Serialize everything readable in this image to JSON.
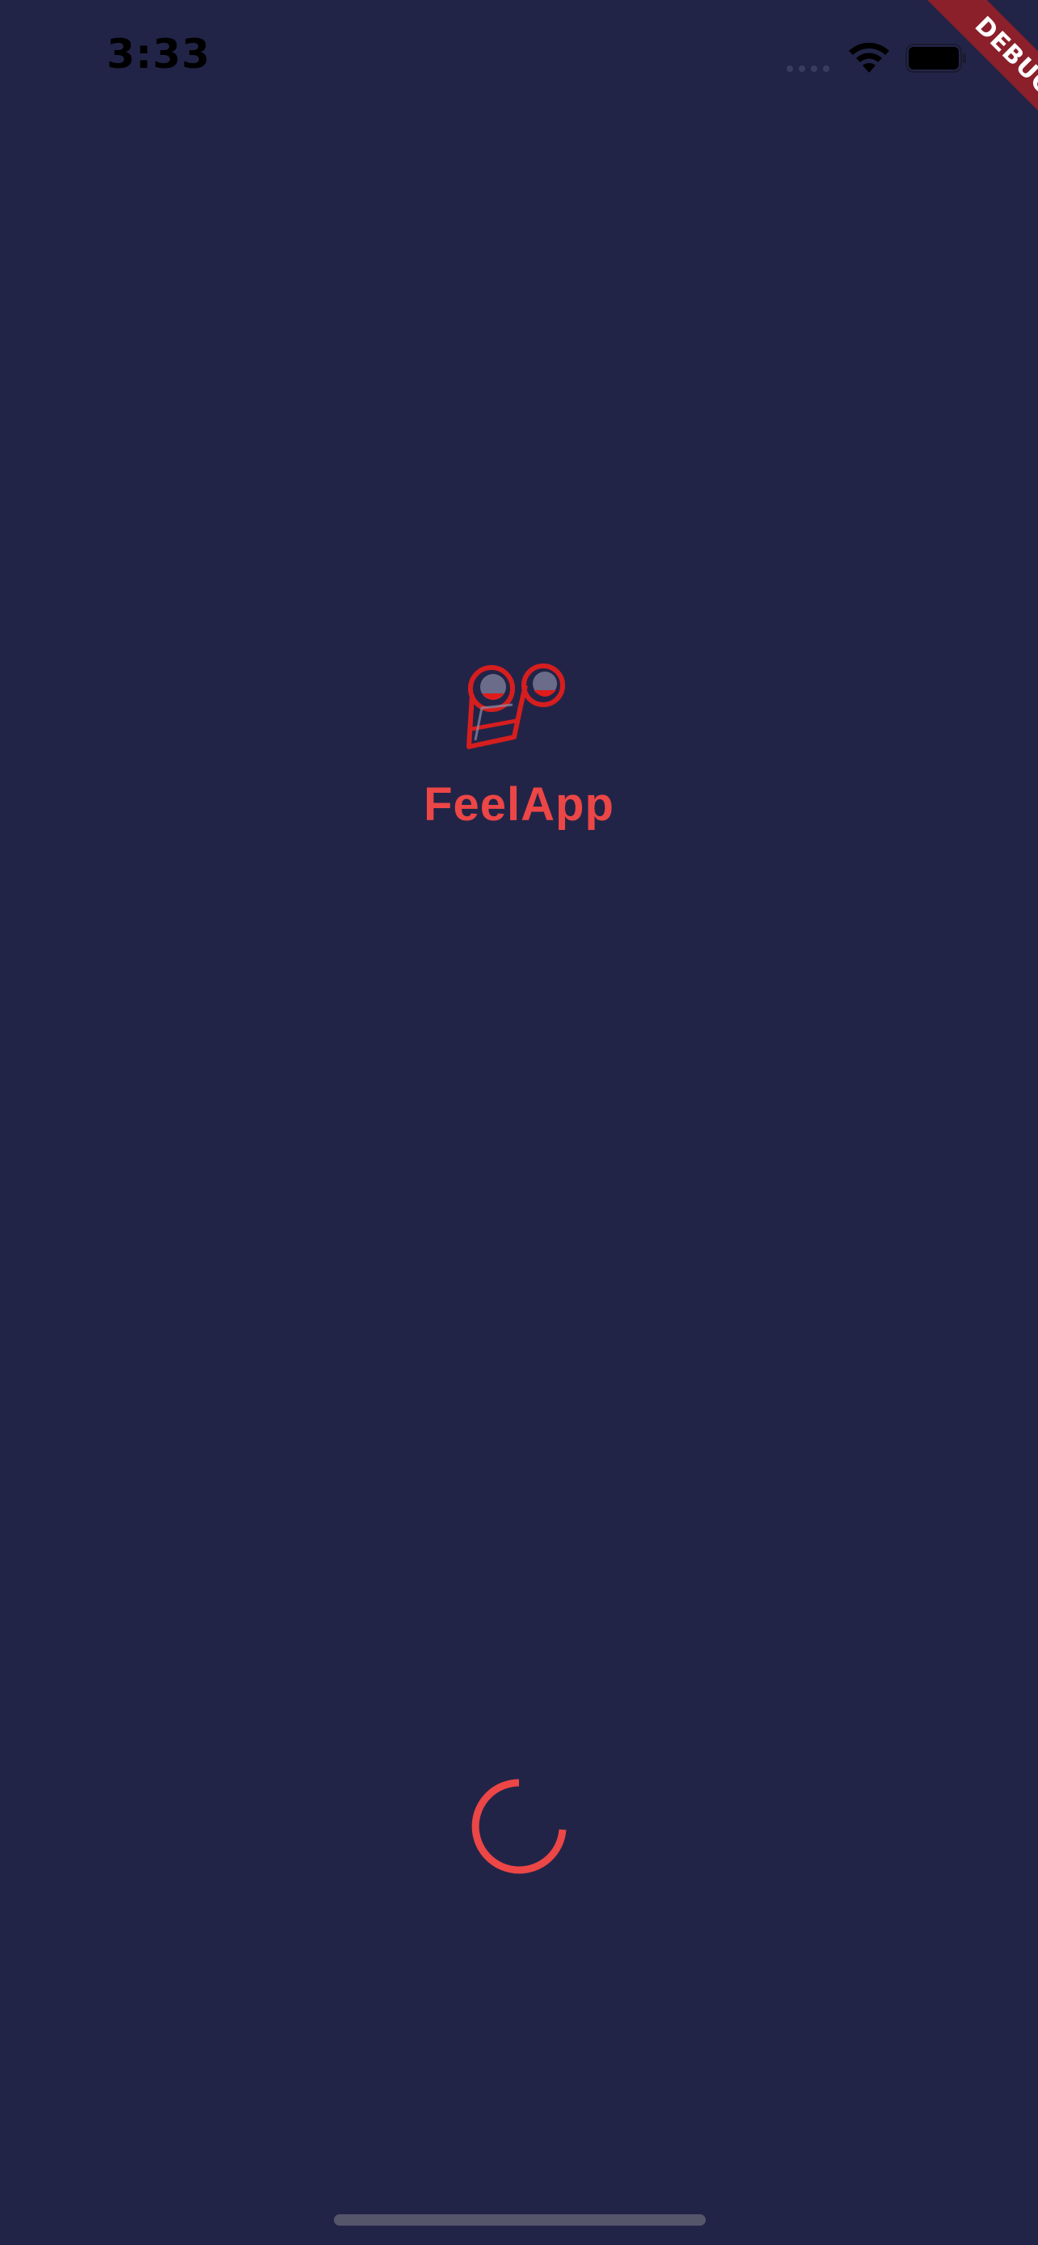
{
  "status_bar": {
    "time": "3:33"
  },
  "debug_banner": {
    "label": "DEBUG",
    "color": "#8b1f2a"
  },
  "splash": {
    "app_name": "FeelApp",
    "logo_icon": "feelapp-face-logo-icon",
    "accent_color": "#ec4646",
    "background_color": "#222447"
  },
  "loader": {
    "icon": "loading-spinner-icon"
  }
}
